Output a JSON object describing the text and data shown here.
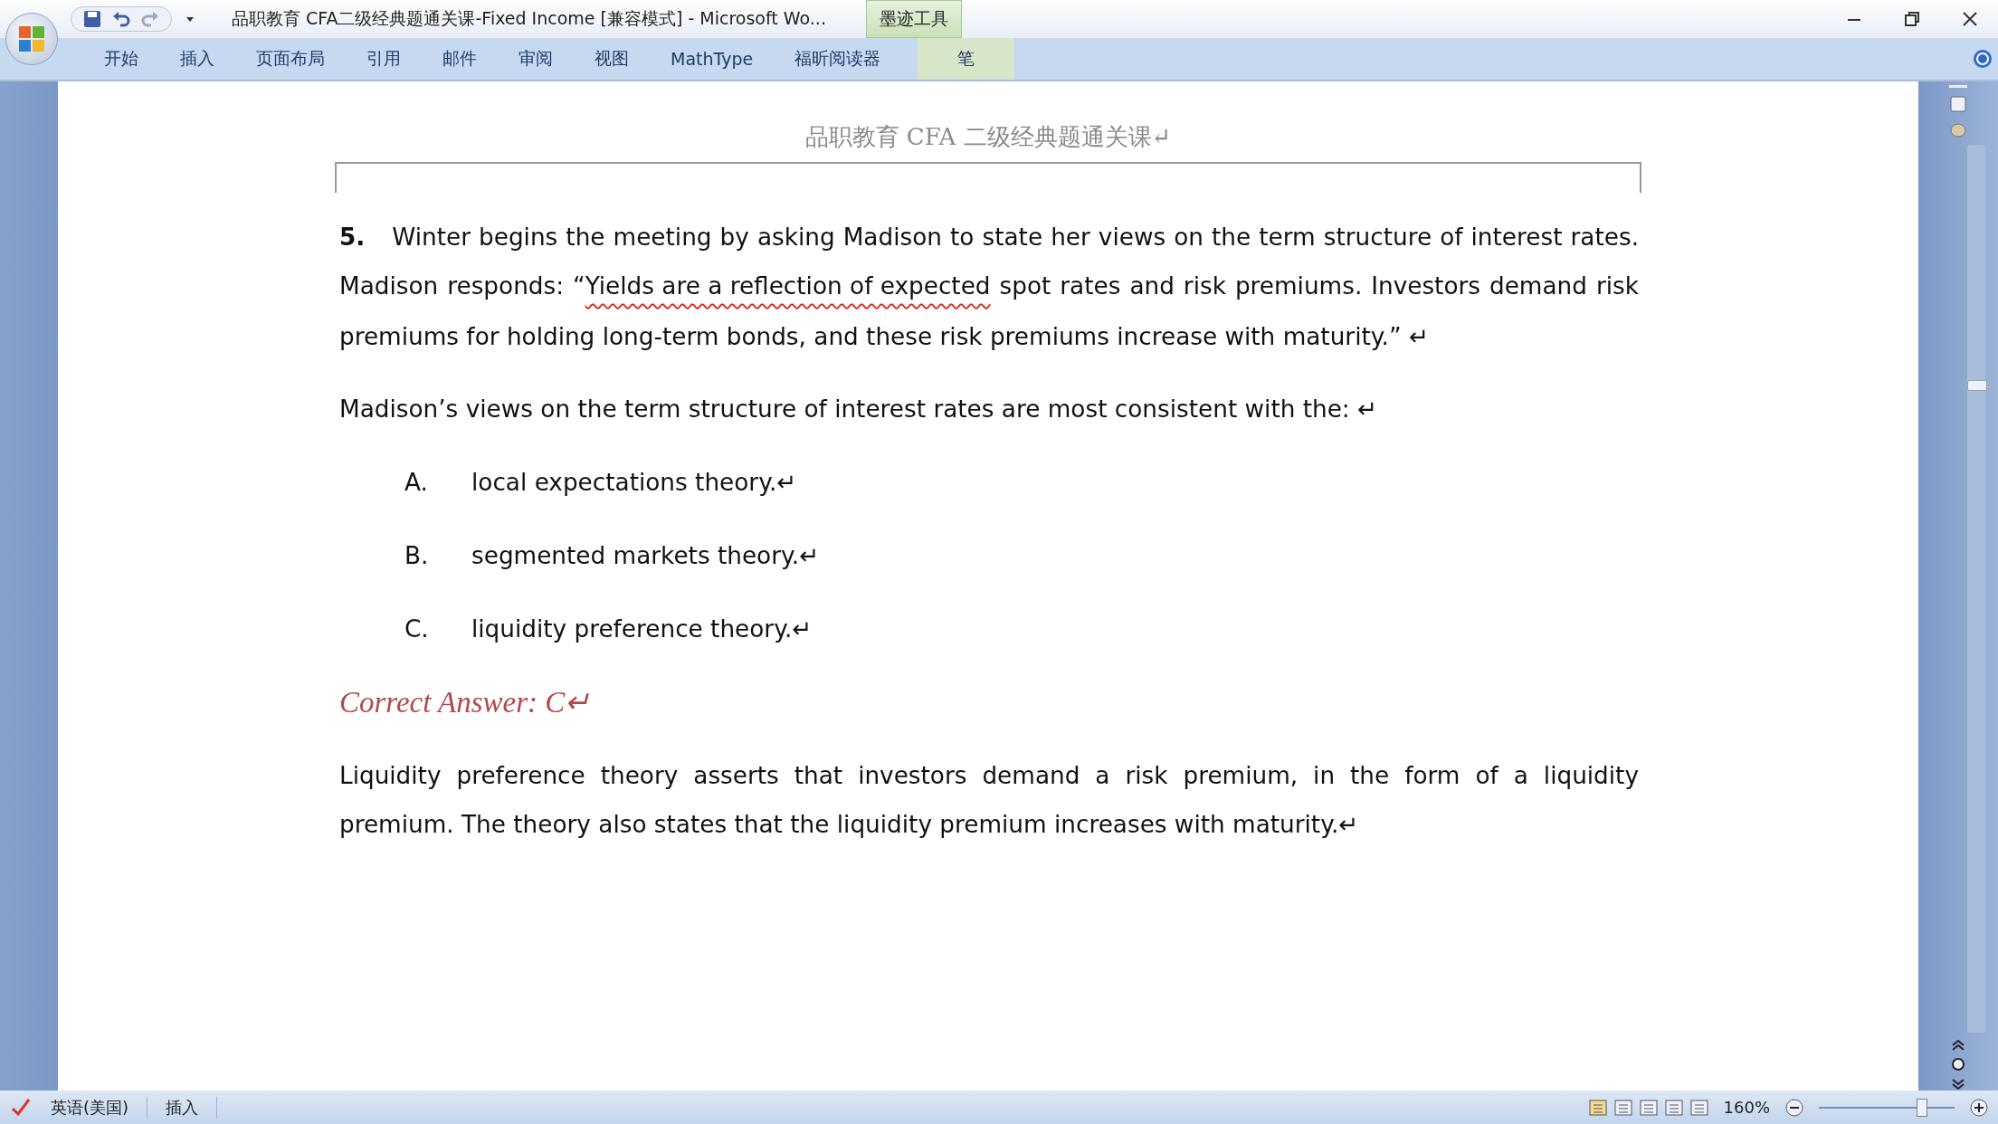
{
  "window": {
    "title": "品职教育 CFA二级经典题通关课-Fixed Income [兼容模式] - Microsoft Wo...",
    "contextual_tab": "墨迹工具"
  },
  "ribbon_tabs": [
    {
      "label": "开始",
      "selected": false
    },
    {
      "label": "插入",
      "selected": false
    },
    {
      "label": "页面布局",
      "selected": false
    },
    {
      "label": "引用",
      "selected": false
    },
    {
      "label": "邮件",
      "selected": false
    },
    {
      "label": "审阅",
      "selected": false
    },
    {
      "label": "视图",
      "selected": false
    },
    {
      "label": "MathType",
      "selected": false
    },
    {
      "label": "福昕阅读器",
      "selected": false
    },
    {
      "label": "笔",
      "selected": false,
      "kind": "contextual"
    }
  ],
  "document": {
    "header": "品职教育 CFA 二级经典题通关课↵",
    "question": {
      "segments": [
        {
          "text": "5.",
          "bold": true,
          "ink_underline": false
        },
        {
          "text": "Winter begins the meeting by asking Madison to state her views on the term structure of interest rates. Madison responds: “",
          "bold": false,
          "ink_underline": false
        },
        {
          "text": "Yields are a reflection of expected",
          "bold": false,
          "ink_underline": true
        },
        {
          "text": " spot rates and risk premiums. Investors demand risk premiums for holding long-term bonds, and these risk premiums increase with maturity.” ↵",
          "bold": false,
          "ink_underline": false
        }
      ]
    },
    "prompt": "Madison’s views on the term structure of interest rates are most consistent with the: ↵",
    "options": [
      {
        "letter": "A.",
        "text": "local expectations theory.↵"
      },
      {
        "letter": "B.",
        "text": "segmented markets theory.↵"
      },
      {
        "letter": "C.",
        "text": "liquidity preference theory.↵"
      }
    ],
    "answer": "Correct Answer: C↵",
    "explanation": "Liquidity preference theory asserts that investors demand a risk premium, in the form of a liquidity premium. The theory also states that the liquidity premium increases with maturity.↵"
  },
  "status_bar": {
    "language": "英语(美国)",
    "mode": "插入",
    "zoom": "160%",
    "zoom_slider": {
      "level": 0.75
    }
  }
}
